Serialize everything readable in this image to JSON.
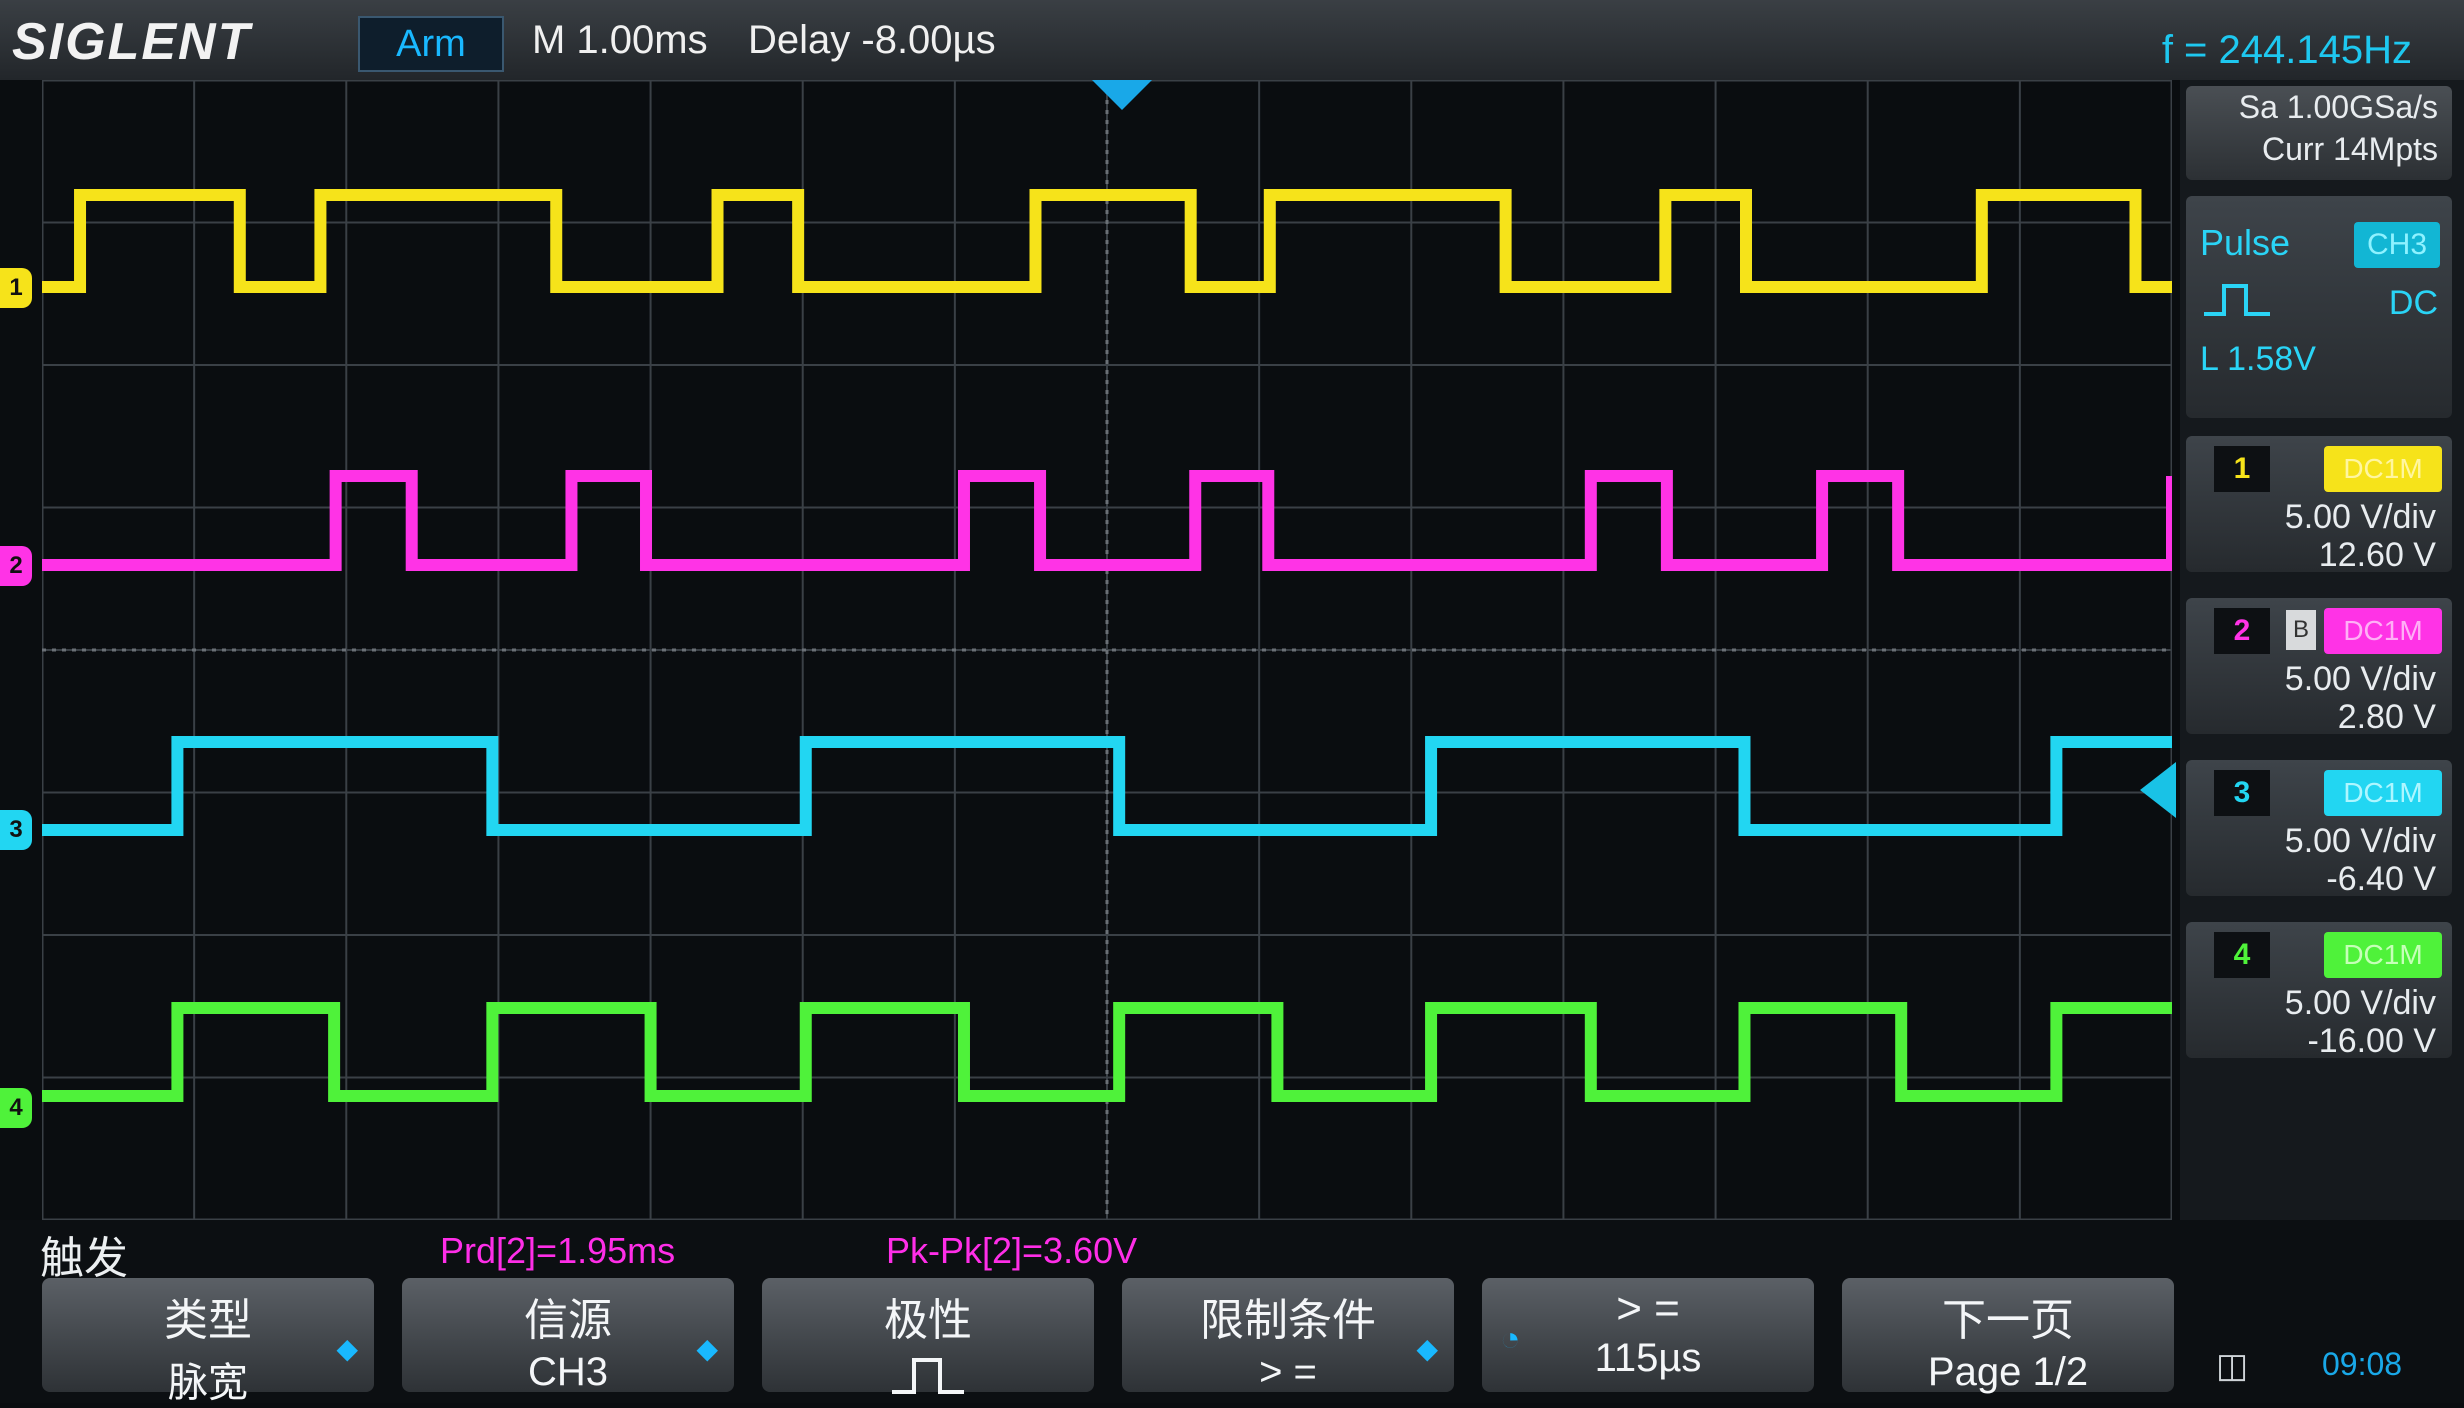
{
  "header": {
    "brand": "SIGLENT",
    "run_state": "Arm",
    "timebase": "M 1.00ms",
    "delay": "Delay -8.00µs",
    "frequency": "f = 244.145Hz"
  },
  "acquisition": {
    "sample_rate": "Sa 1.00GSa/s",
    "memory_depth": "Curr 14Mpts"
  },
  "trigger_panel": {
    "type": "Pulse",
    "source": "CH3",
    "coupling": "DC",
    "level": "L  1.58V"
  },
  "channels": [
    {
      "number": "1",
      "bw_limit": "",
      "coupling": "DC1M",
      "scale": "5.00 V/div",
      "offset": "12.60 V",
      "color": "#f6e31a"
    },
    {
      "number": "2",
      "bw_limit": "B",
      "coupling": "DC1M",
      "scale": "5.00 V/div",
      "offset": "2.80 V",
      "color": "#ff33e6"
    },
    {
      "number": "3",
      "bw_limit": "",
      "coupling": "DC1M",
      "scale": "5.00 V/div",
      "offset": "-6.40 V",
      "color": "#22d6f2"
    },
    {
      "number": "4",
      "bw_limit": "",
      "coupling": "DC1M",
      "scale": "5.00 V/div",
      "offset": "-16.00 V",
      "color": "#4ff23a"
    }
  ],
  "measurements": {
    "period": "Prd[2]=1.95ms",
    "pk_pk": "Pk-Pk[2]=3.60V"
  },
  "menu": {
    "title": "触发",
    "softkeys": [
      {
        "line1": "类型",
        "line2": "脉宽"
      },
      {
        "line1": "信源",
        "line2": "CH3"
      },
      {
        "line1": "极性",
        "line2": ""
      },
      {
        "line1": "限制条件",
        "line2": "> ="
      },
      {
        "line1": "> =",
        "line2": "115µs"
      },
      {
        "line1": "下一页",
        "line2": "Page 1/2"
      }
    ]
  },
  "status": {
    "time": "09:08"
  },
  "waveforms": {
    "ch1_edges_div": [
      0.25,
      1.3,
      1.83,
      3.38,
      4.44,
      4.97,
      6.53,
      7.55,
      8.07,
      9.62,
      10.67,
      11.2,
      12.75,
      13.76
    ],
    "ch1_start_high": false,
    "ch2_edges_div": [
      0.0,
      1.93,
      2.43,
      3.48,
      3.97,
      6.06,
      6.56,
      7.58,
      8.06,
      10.18,
      10.68,
      11.7,
      12.2,
      14.0
    ],
    "ch2_start_high": true,
    "ch3_edges_div": [
      0.89,
      2.96,
      5.02,
      7.08,
      9.13,
      11.19,
      13.24
    ],
    "ch3_start_high": false,
    "ch4_edges_div": [
      0.89,
      1.92,
      2.96,
      4.0,
      5.02,
      6.06,
      7.08,
      8.12,
      9.13,
      10.18,
      11.19,
      12.22,
      13.24
    ],
    "ch4_start_high": false
  }
}
